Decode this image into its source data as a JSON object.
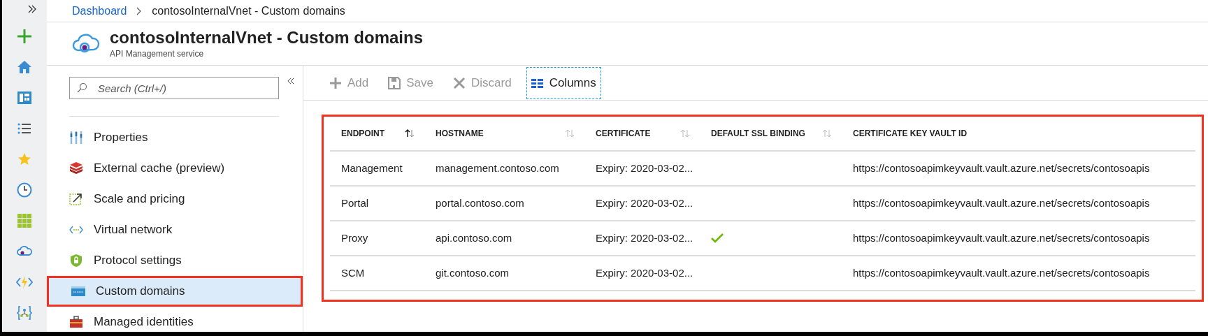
{
  "breadcrumb": {
    "link": "Dashboard",
    "current": "contosoInternalVnet - Custom domains"
  },
  "header": {
    "title": "contosoInternalVnet - Custom domains",
    "subtitle": "API Management service"
  },
  "search": {
    "placeholder": "Search (Ctrl+/)"
  },
  "menu": [
    {
      "label": "Properties",
      "kind": "properties",
      "selected": false,
      "annotated": false
    },
    {
      "label": "External cache (preview)",
      "kind": "cache",
      "selected": false,
      "annotated": false
    },
    {
      "label": "Scale and pricing",
      "kind": "scale",
      "selected": false,
      "annotated": false
    },
    {
      "label": "Virtual network",
      "kind": "vnet",
      "selected": false,
      "annotated": false
    },
    {
      "label": "Protocol settings",
      "kind": "shield",
      "selected": false,
      "annotated": false
    },
    {
      "label": "Custom domains",
      "kind": "www",
      "selected": true,
      "annotated": true
    },
    {
      "label": "Managed identities",
      "kind": "toolbox",
      "selected": false,
      "annotated": false
    }
  ],
  "toolbar": [
    {
      "label": "Add",
      "kind": "add",
      "disabled": true,
      "focused": false
    },
    {
      "label": "Save",
      "kind": "save",
      "disabled": true,
      "focused": false
    },
    {
      "label": "Discard",
      "kind": "discard",
      "disabled": true,
      "focused": false
    },
    {
      "label": "Columns",
      "kind": "columns",
      "disabled": false,
      "focused": true
    }
  ],
  "table": {
    "annotated": true,
    "columns": [
      {
        "label": "ENDPOINT",
        "sortable": true,
        "sorted": true
      },
      {
        "label": "HOSTNAME",
        "sortable": true,
        "sorted": false
      },
      {
        "label": "CERTIFICATE",
        "sortable": true,
        "sorted": false
      },
      {
        "label": "DEFAULT SSL BINDING",
        "sortable": true,
        "sorted": false
      },
      {
        "label": "CERTIFICATE KEY VAULT ID",
        "sortable": false,
        "sorted": false
      }
    ],
    "rows": [
      {
        "endpoint": "Management",
        "hostname": "management.contoso.com",
        "certificate": "Expiry: 2020-03-02...",
        "default_ssl": false,
        "key_vault_id": "https://contosoapimkeyvault.vault.azure.net/secrets/contosoapis"
      },
      {
        "endpoint": "Portal",
        "hostname": "portal.contoso.com",
        "certificate": "Expiry: 2020-03-02...",
        "default_ssl": false,
        "key_vault_id": "https://contosoapimkeyvault.vault.azure.net/secrets/contosoapis"
      },
      {
        "endpoint": "Proxy",
        "hostname": "api.contoso.com",
        "certificate": "Expiry: 2020-03-02...",
        "default_ssl": true,
        "key_vault_id": "https://contosoapimkeyvault.vault.azure.net/secrets/contosoapis"
      },
      {
        "endpoint": "SCM",
        "hostname": "git.contoso.com",
        "certificate": "Expiry: 2020-03-02...",
        "default_ssl": false,
        "key_vault_id": "https://contosoapimkeyvault.vault.azure.net/secrets/contosoapis"
      }
    ]
  }
}
